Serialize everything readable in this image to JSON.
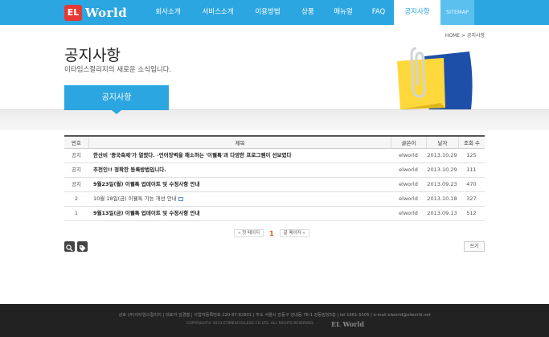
{
  "header": {
    "logo_mark": "EL",
    "logo_word": "World",
    "nav": [
      {
        "label": "회사소개",
        "width": 62
      },
      {
        "label": "서비스소개",
        "width": 62
      },
      {
        "label": "이용방법",
        "width": 62
      },
      {
        "label": "상품",
        "width": 38
      },
      {
        "label": "매뉴얼",
        "width": 50
      },
      {
        "label": "FAQ",
        "width": 38
      },
      {
        "label": "공지사항",
        "width": 58
      },
      {
        "label": "SITEMAP",
        "width": 42
      }
    ],
    "accent_color": "#2ca6e0"
  },
  "breadcrumb": "HOME > 공지사항",
  "page": {
    "title": "공지사항",
    "subtitle": "이타임스컬리지의 새로운 소식입니다.",
    "tab_label": "공지사항"
  },
  "board": {
    "headers": {
      "no": "번호",
      "title": "제목",
      "writer": "글쓴이",
      "date": "날자",
      "views": "조회 수"
    },
    "rows": [
      {
        "no": "공지",
        "title": "한산비 '중국축제'가 열렸다. -언어장벽을 해소하는 '이웰톡'과 다양한 프로그램이 선보였다",
        "writer": "elworld",
        "date": "2013.10.29",
        "views": "125",
        "bold": true,
        "new": false
      },
      {
        "no": "공지",
        "title": "추천인!! 정확한 등록방법입니다.",
        "writer": "elworld",
        "date": "2013.10.29",
        "views": "111",
        "bold": true,
        "new": false
      },
      {
        "no": "공지",
        "title": "9월23일(월) 이웰톡 업데이트 및 수정사항 안내",
        "writer": "elworld",
        "date": "2013.09.23",
        "views": "470",
        "bold": true,
        "new": false
      },
      {
        "no": "2",
        "title": "10월 18일(금) 이웰톡 기능 개선 안내",
        "writer": "elworld",
        "date": "2013.10.18",
        "views": "327",
        "bold": false,
        "new": true
      },
      {
        "no": "1",
        "title": "9월13일(금) 이웰톡 업데이트 및 수정사항 안내",
        "writer": "elworld",
        "date": "2013.09.13",
        "views": "512",
        "bold": true,
        "new": false
      }
    ]
  },
  "pager": {
    "first": "« 첫 페이지",
    "current": "1",
    "last": "끝 페이지 »"
  },
  "actions": {
    "search_icon": "search-icon",
    "tag_icon": "tag-icon",
    "write_label": "쓰기"
  },
  "footer": {
    "info": "상호 (주)이타임스컬리지 | 대표자 김경철 | 사업자등록번호 220-87-82801 | 주소 서울시 강동구 성내동 78-1 강동빌딩5층 | tel 1661-5505 | e-mail elworld@elworld.net",
    "copyright": "COPYRIGHT© 2013 ETIMESCOLLEGE.CO.LTD. ALL RIGHTS RESERVED.",
    "logo": "EL World"
  }
}
